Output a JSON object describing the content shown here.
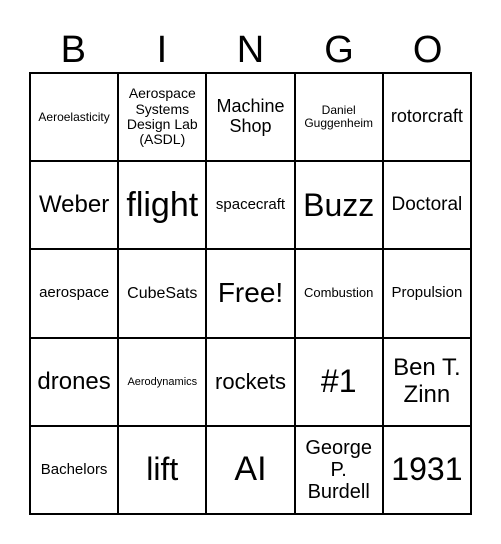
{
  "header": {
    "letters": [
      "B",
      "I",
      "N",
      "G",
      "O"
    ]
  },
  "cells": [
    "Aeroelasticity",
    "Aerospace Systems Design Lab (ASDL)",
    "Machine Shop",
    "Daniel Guggenheim",
    "rotorcraft",
    "Weber",
    "flight",
    "spacecraft",
    "Buzz",
    "Doctoral",
    "aerospace",
    "CubeSats",
    "Free!",
    "Combustion",
    "Propulsion",
    "drones",
    "Aerodynamics",
    "rockets",
    "#1",
    "Ben T. Zinn",
    "Bachelors",
    "lift",
    "AI",
    "George P. Burdell",
    "1931"
  ]
}
